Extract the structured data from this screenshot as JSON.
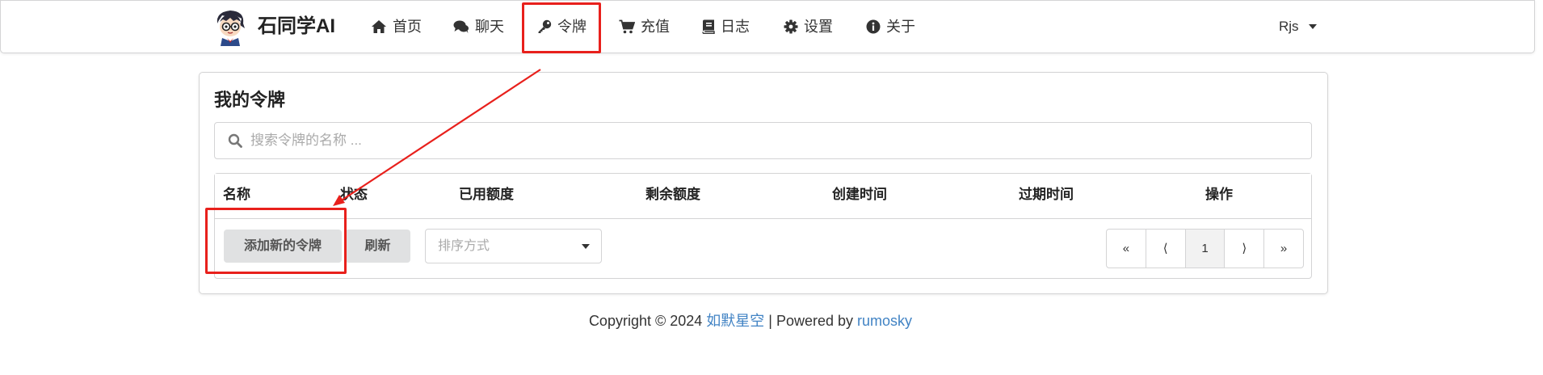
{
  "nav": {
    "brand": "石同学AI",
    "items": [
      {
        "label": "首页",
        "icon": "home-icon"
      },
      {
        "label": "聊天",
        "icon": "comments-icon"
      },
      {
        "label": "令牌",
        "icon": "key-icon"
      },
      {
        "label": "充值",
        "icon": "cart-icon"
      },
      {
        "label": "日志",
        "icon": "book-icon"
      },
      {
        "label": "设置",
        "icon": "gear-icon"
      },
      {
        "label": "关于",
        "icon": "info-icon"
      }
    ],
    "user": "Rjs"
  },
  "page": {
    "title": "我的令牌",
    "search_placeholder": "搜索令牌的名称 ..."
  },
  "table": {
    "columns": [
      "名称",
      "状态",
      "已用额度",
      "剩余额度",
      "创建时间",
      "过期时间",
      "操作"
    ]
  },
  "actions": {
    "add_label": "添加新的令牌",
    "refresh_label": "刷新",
    "sort_placeholder": "排序方式"
  },
  "pagination": {
    "first": "«",
    "prev": "⟨",
    "page": "1",
    "next": "⟩",
    "last": "»"
  },
  "footer": {
    "prefix": "Copyright © 2024 ",
    "author": "如默星空",
    "mid": " | Powered by ",
    "powered": "rumosky"
  },
  "colors": {
    "highlight": "#e8201c",
    "link": "#4183c4",
    "button_bg": "#e0e1e2"
  }
}
